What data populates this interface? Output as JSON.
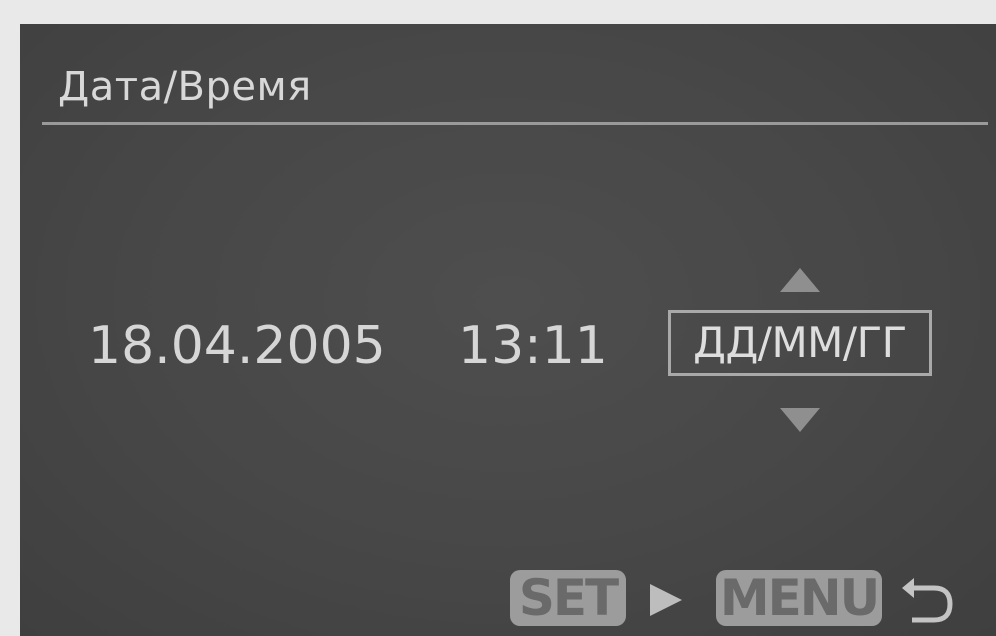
{
  "screen": {
    "title": "Дата/Время",
    "date": "18.04.2005",
    "time": "13:11",
    "format": "ДД/ММ/ГГ"
  },
  "controls": {
    "set_label": "SET",
    "menu_label": "MENU"
  },
  "icons": {
    "up": "arrow-up-icon",
    "down": "arrow-down-icon",
    "play": "play-icon",
    "return": "return-icon"
  },
  "colors": {
    "screen_bg": "#474747",
    "text": "#d8d8d8",
    "button_bg": "#9c9c9c"
  }
}
